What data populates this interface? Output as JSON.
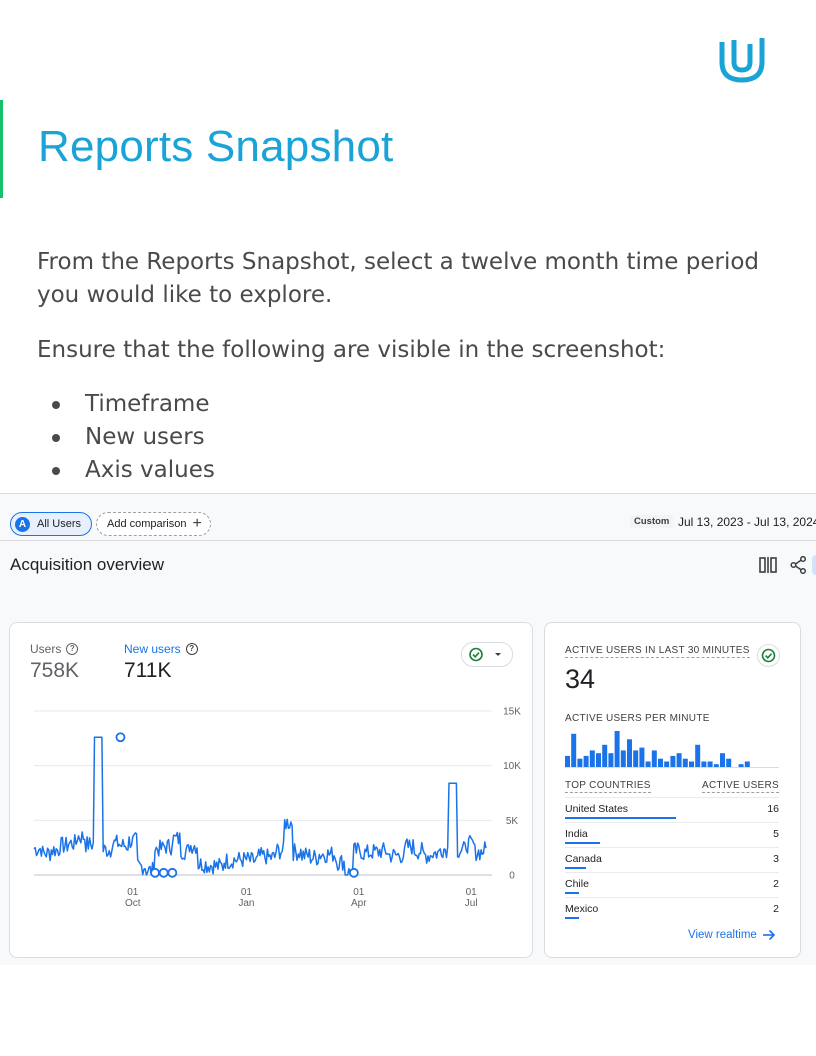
{
  "doc": {
    "title": "Reports Snapshot",
    "paragraph1": "From the Reports Snapshot, select a twelve month time period you would like to explore.",
    "paragraph2": "Ensure that the following are visible in the screenshot:",
    "bullets": [
      "Timeframe",
      "New users",
      "Axis values"
    ]
  },
  "ga": {
    "comparison_chip": "All Users",
    "comparison_letter": "A",
    "add_comparison": "Add comparison",
    "date_tag": "Custom",
    "date_range": "Jul 13, 2023 - Jul 13, 2024",
    "page_title": "Acquisition overview",
    "metrics": [
      {
        "label": "Users",
        "value": "758K"
      },
      {
        "label": "New users",
        "value": "711K"
      }
    ],
    "realtime": {
      "title": "ACTIVE USERS IN LAST 30 MINUTES",
      "value": "34",
      "per_minute_label": "ACTIVE USERS PER MINUTE",
      "per_minute_values": [
        4,
        12,
        3,
        4,
        6,
        5,
        8,
        5,
        13,
        6,
        10,
        6,
        7,
        2,
        6,
        3,
        2,
        4,
        5,
        3,
        2,
        8,
        2,
        2,
        1,
        5,
        3,
        0,
        1,
        2
      ],
      "countries_header": "TOP COUNTRIES",
      "users_header": "ACTIVE USERS",
      "countries": [
        {
          "name": "United States",
          "value": "16",
          "share": 16
        },
        {
          "name": "India",
          "value": "5",
          "share": 5
        },
        {
          "name": "Canada",
          "value": "3",
          "share": 3
        },
        {
          "name": "Chile",
          "value": "2",
          "share": 2
        },
        {
          "name": "Mexico",
          "value": "2",
          "share": 2
        }
      ],
      "link": "View realtime"
    },
    "colors": {
      "accent": "#1a73e8",
      "title": "#1aa3d6",
      "green": "#188038"
    }
  },
  "chart_data": {
    "type": "line",
    "title": "",
    "xlabel": "",
    "ylabel": "",
    "x_ticks": [
      {
        "day": "01",
        "month": "Oct"
      },
      {
        "day": "01",
        "month": "Jan"
      },
      {
        "day": "01",
        "month": "Apr"
      },
      {
        "day": "01",
        "month": "Jul"
      }
    ],
    "y_ticks": [
      "0",
      "5K",
      "10K",
      "15K"
    ],
    "ylim": [
      0,
      15000
    ],
    "x_start": "2023-07-13",
    "x_end": "2024-07-13",
    "series": [
      {
        "name": "New users",
        "weekly_values": [
          2400,
          2000,
          2300,
          2700,
          2900,
          3500,
          2800,
          12600,
          2300,
          2900,
          2700,
          3100,
          800,
          400,
          2400,
          2600,
          3300,
          2200,
          2700,
          1000,
          900,
          800,
          1300,
          1400,
          1400,
          1300,
          1700,
          1600,
          2200,
          4800,
          2100,
          1800,
          1600,
          1900,
          1900,
          1200,
          200,
          2200,
          2000,
          2100,
          2200,
          1800,
          1800,
          2600,
          2200,
          1800,
          2000,
          2400,
          8400,
          2300,
          2800,
          2100,
          2300
        ]
      }
    ],
    "point_markers": [
      {
        "date": "2023-09-21",
        "value": 12600
      },
      {
        "date": "2023-10-19",
        "value": 200
      },
      {
        "date": "2023-10-26",
        "value": 200
      },
      {
        "date": "2023-11-02",
        "value": 200
      },
      {
        "date": "2024-03-28",
        "value": 200
      }
    ]
  }
}
